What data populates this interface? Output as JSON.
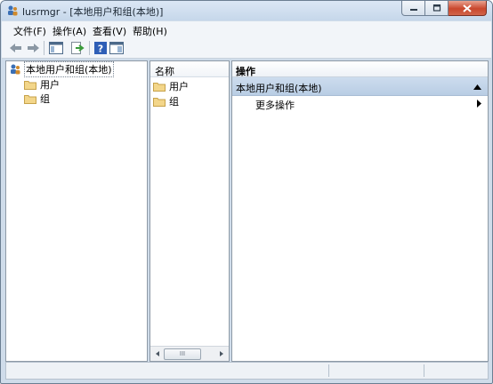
{
  "window": {
    "title": "lusrmgr - [本地用户和组(本地)]",
    "accent": "#c9472d"
  },
  "menu": {
    "items": [
      "文件(F)",
      "操作(A)",
      "查看(V)",
      "帮助(H)"
    ]
  },
  "tree": {
    "root": "本地用户和组(本地)",
    "children": [
      "用户",
      "组"
    ]
  },
  "list": {
    "header": "名称",
    "items": [
      "用户",
      "组"
    ],
    "scroll_thumb": "III"
  },
  "actions": {
    "header": "操作",
    "section_title": "本地用户和组(本地)",
    "more": "更多操作"
  },
  "icons": [
    "app-icon",
    "back-arrow-icon",
    "forward-arrow-icon",
    "show-hide-tree-icon",
    "export-list-icon",
    "help-icon",
    "show-hide-action-pane-icon",
    "folder-icon",
    "computer-users-icon"
  ]
}
